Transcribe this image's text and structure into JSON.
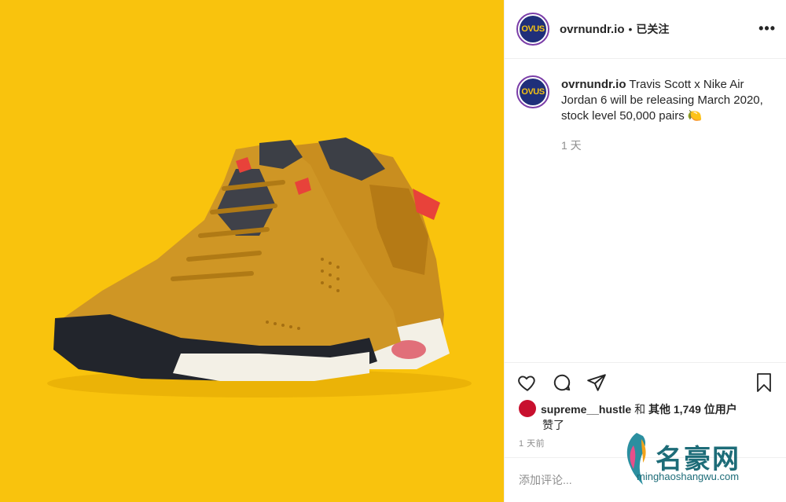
{
  "post": {
    "username": "ovrnundr.io",
    "separator": "•",
    "follow_status": "已关注",
    "more_icon": "more-options-icon",
    "avatar_text": "OVUS"
  },
  "caption": {
    "username": "ovrnundr.io",
    "text": "Travis Scott x Nike Air Jordan 6 will be releasing March 2020, stock level 50,000 pairs 🍋",
    "time": "1 天"
  },
  "actions": {
    "like_icon": "heart-icon",
    "comment_icon": "comment-icon",
    "share_icon": "share-icon",
    "save_icon": "bookmark-icon"
  },
  "likes": {
    "liker": "supreme__hustle",
    "connector": "和",
    "others": "其他 1,749 位用户",
    "suffix": "赞了"
  },
  "timestamp": "1 天前",
  "comment": {
    "placeholder": "添加评论..."
  },
  "watermark": {
    "brand": "名豪网",
    "url": "minghaoshangwu.com"
  },
  "colors": {
    "media_bg": "#f9c30d",
    "text": "#262626",
    "muted": "#8e8e8e",
    "border": "#efefef"
  }
}
